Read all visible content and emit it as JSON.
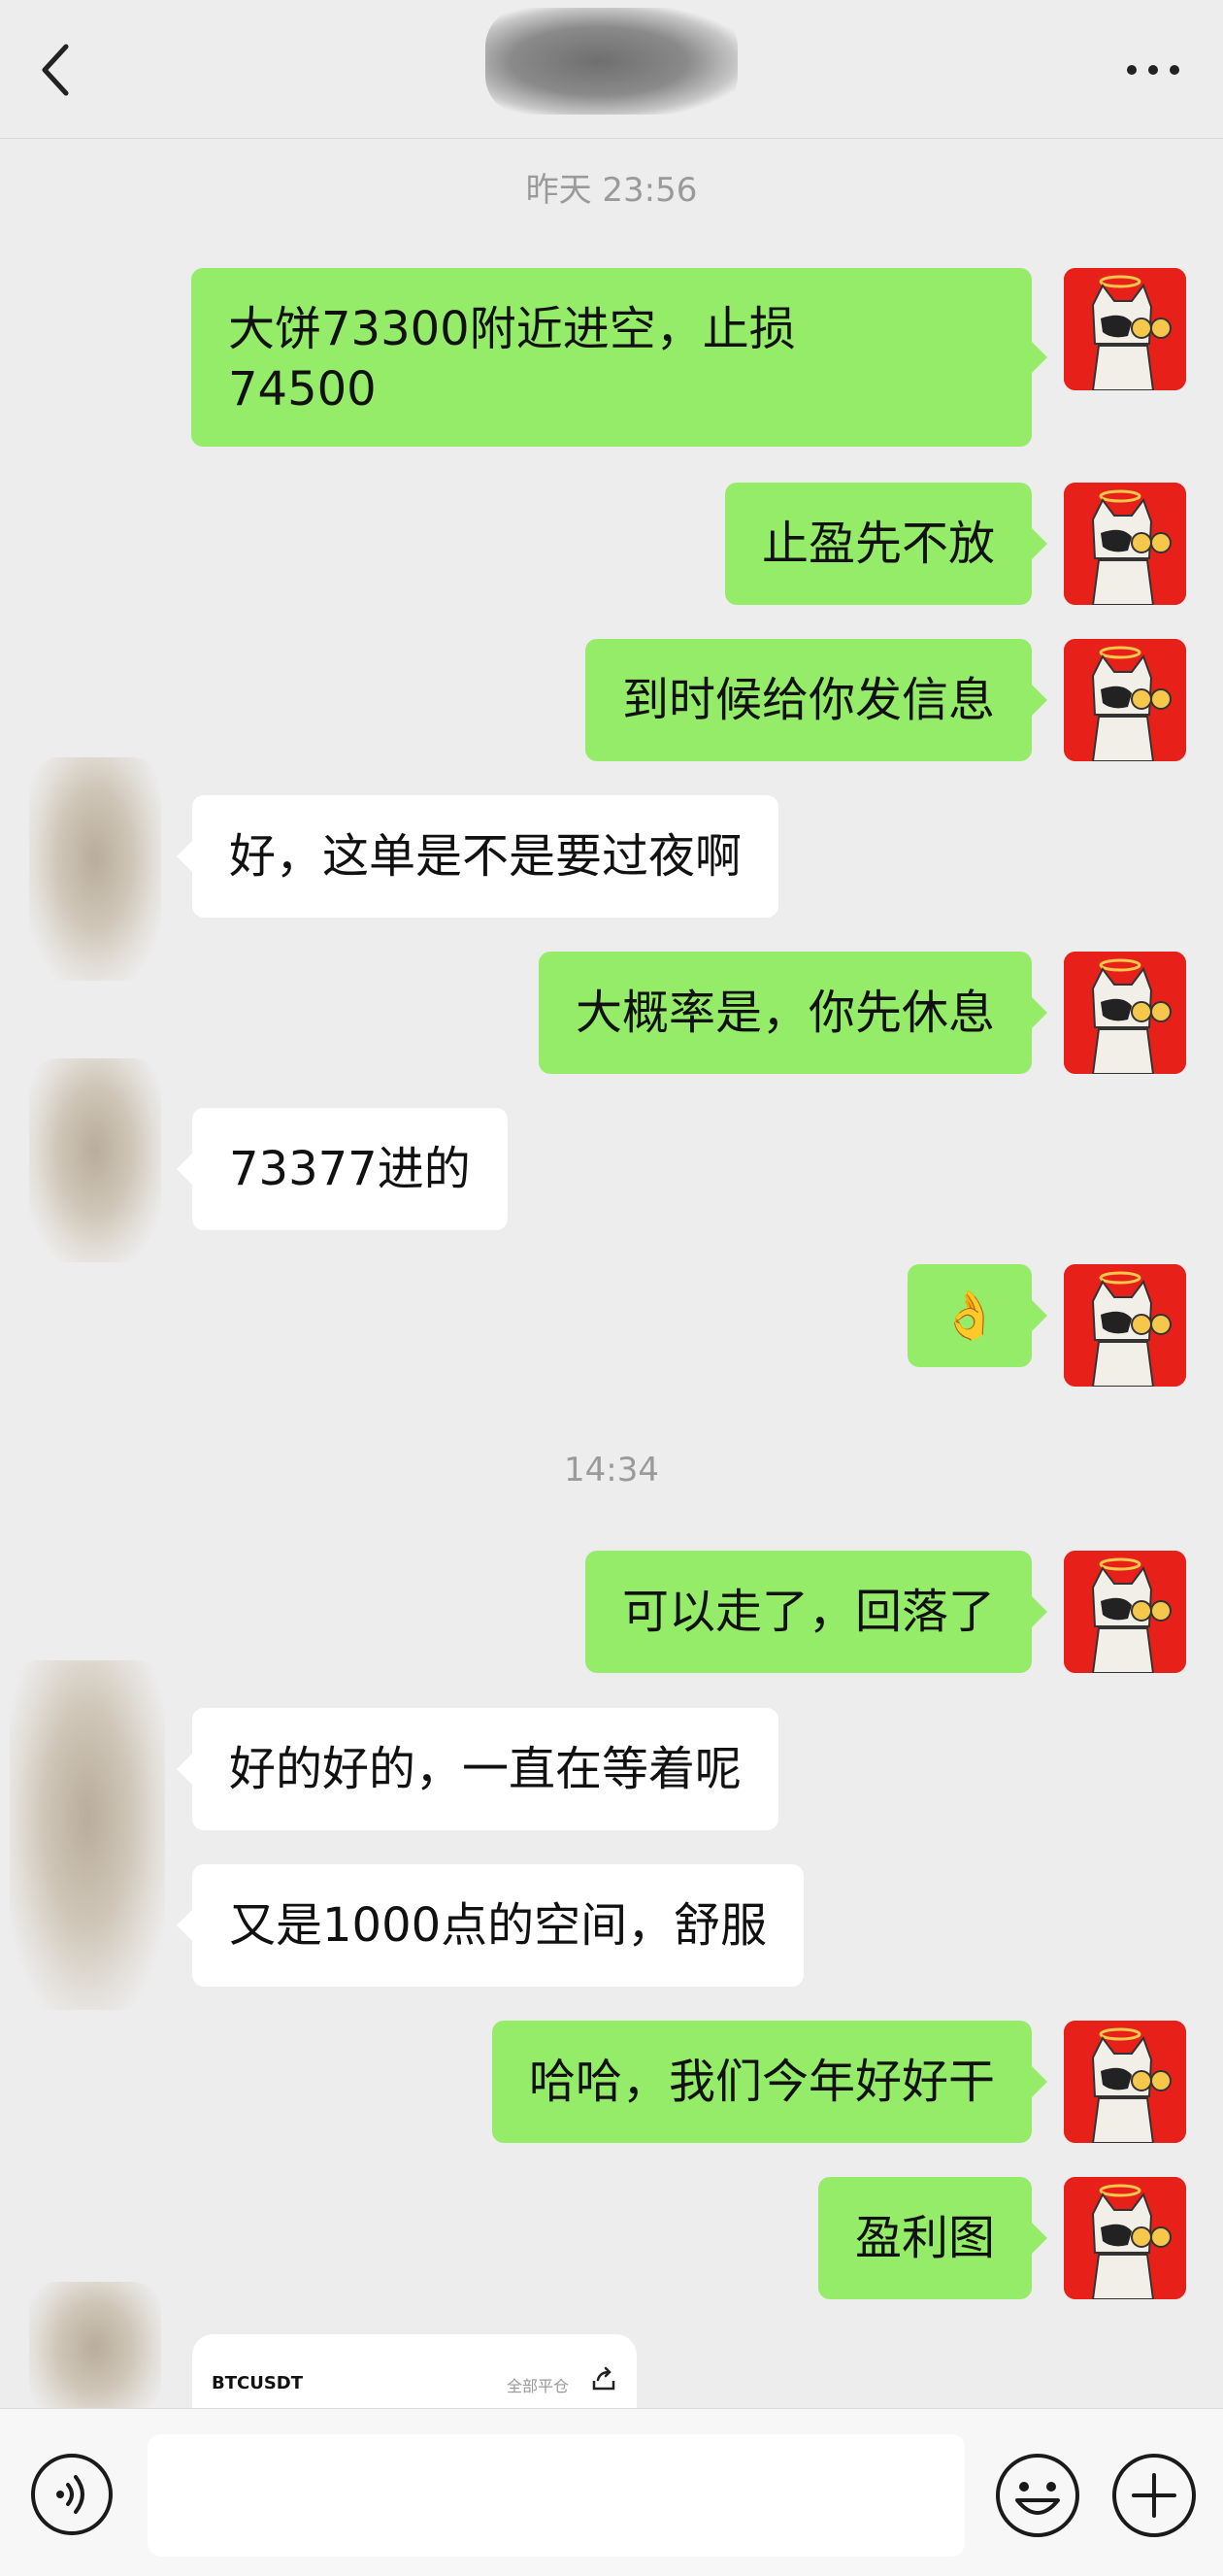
{
  "header": {
    "back_icon": "chevron-left-icon",
    "more_icon": "more-dots-icon"
  },
  "messages": [
    {
      "type": "timestamp",
      "text": "昨天 23:56"
    },
    {
      "from": "me",
      "lines": [
        "大饼73300附近进空，止损",
        "74500"
      ]
    },
    {
      "from": "me",
      "text": "止盈先不放"
    },
    {
      "from": "me",
      "text": "到时候给你发信息"
    },
    {
      "from": "them",
      "text": "好，这单是不是要过夜啊"
    },
    {
      "from": "me",
      "text": "大概率是，你先休息"
    },
    {
      "from": "them",
      "text": "73377进的"
    },
    {
      "from": "me",
      "text": "👌"
    },
    {
      "type": "timestamp",
      "text": "14:34"
    },
    {
      "from": "me",
      "text": "可以走了，回落了"
    },
    {
      "from": "them",
      "text": "好的好的，一直在等着呢"
    },
    {
      "from": "them",
      "text": "又是1000点的空间，舒服"
    },
    {
      "from": "me",
      "text": "哈哈，我们今年好好干"
    },
    {
      "from": "me",
      "text": "盈利图"
    }
  ],
  "card": {
    "symbol": "BTCUSDT",
    "action": "全部平仓",
    "share_icon": "share-icon"
  },
  "bottom_bar": {
    "voice_icon": "voice-icon",
    "input_value": "",
    "emoji_icon": "emoji-icon",
    "plus_icon": "plus-icon"
  },
  "colors": {
    "me_bubble": "#95ec69",
    "them_bubble": "#ffffff",
    "background": "#ededed",
    "me_avatar": "#e8201a"
  }
}
